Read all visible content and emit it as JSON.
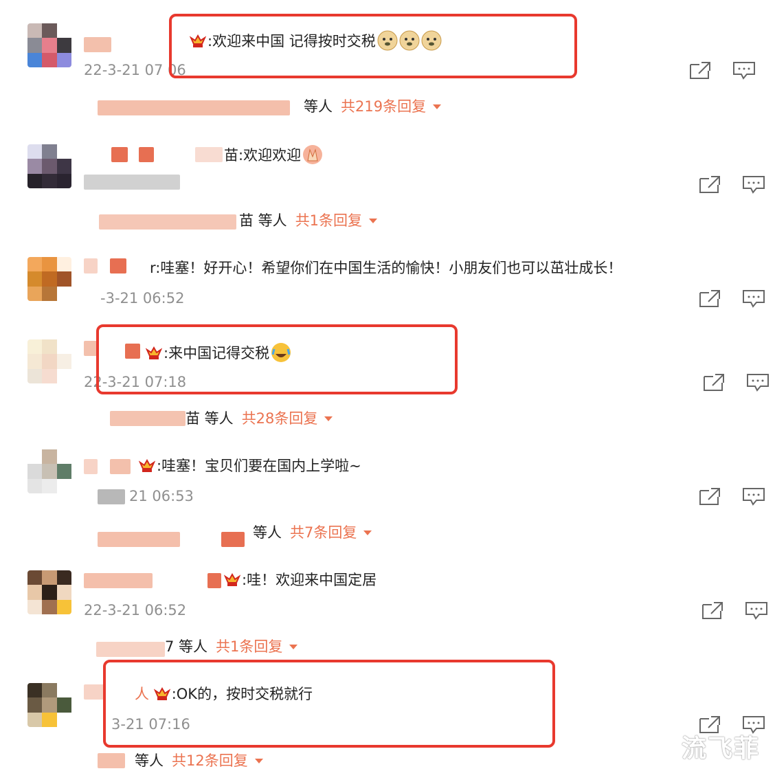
{
  "colors": {
    "accent": "#eb7350",
    "highlight": "#e8392e",
    "time": "#8f8f8f"
  },
  "comments": [
    {
      "text": ":欢迎来中国 记得按时交税",
      "time": "22-3-21 07 06",
      "reply_people": "等人",
      "reply_total": "共219条回复",
      "emoji": "doge-emoji",
      "emoji_count": 3
    },
    {
      "text": "苗:欢迎欢迎",
      "time": "",
      "reply_people": "苗 等人",
      "reply_total": "共1条回复",
      "emoji": "clap-emoji"
    },
    {
      "text": "r:哇塞！好开心！希望你们在中国生活的愉快！小朋友们也可以茁壮成长！",
      "time": "-3-21 06:52"
    },
    {
      "text": ":来中国记得交税",
      "time": "22-3-21 07:18",
      "reply_people": "苗 等人",
      "reply_total": "共28条回复",
      "emoji": "laugh-cry-emoji"
    },
    {
      "text": ":哇塞！宝贝们要在国内上学啦~",
      "time": "21 06:53",
      "reply_people": "等人",
      "reply_total": "共7条回复"
    },
    {
      "text": ":哇！欢迎来中国定居",
      "time": "22-3-21 06:52",
      "reply_people": "7 等人",
      "reply_total": "共1条回复"
    },
    {
      "text": ":OK的，按时交税就行",
      "time": "3-21 07:16",
      "reply_people": "等人",
      "reply_total": "共12条回复"
    }
  ],
  "watermark": "流飞菲"
}
